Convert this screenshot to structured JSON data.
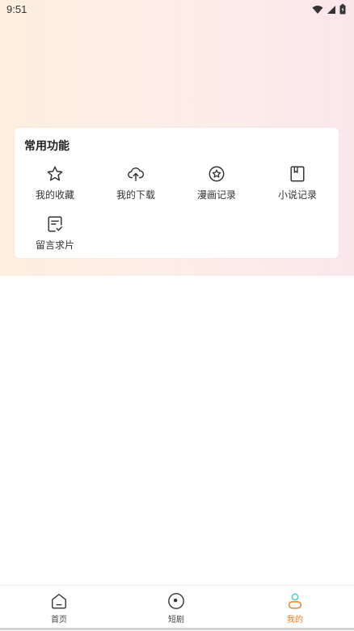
{
  "status_bar": {
    "time": "9:51",
    "icons": [
      "wifi-icon",
      "signal-icon",
      "battery-icon"
    ]
  },
  "common_functions": {
    "title": "常用功能",
    "items": [
      {
        "label": "我的收藏",
        "icon": "star-icon"
      },
      {
        "label": "我的下载",
        "icon": "cloud-upload-icon"
      },
      {
        "label": "漫画记录",
        "icon": "star-circle-icon"
      },
      {
        "label": "小说记录",
        "icon": "book-bookmark-icon"
      },
      {
        "label": "留言求片",
        "icon": "note-check-icon"
      }
    ]
  },
  "tab_bar": {
    "tabs": [
      {
        "label": "首页",
        "icon": "home-icon",
        "active": false
      },
      {
        "label": "短剧",
        "icon": "play-circle-icon",
        "active": false
      },
      {
        "label": "我的",
        "icon": "profile-icon",
        "active": true
      }
    ]
  },
  "colors": {
    "accent": "#ff7a1a",
    "profile_icon_teal": "#3fd6c9",
    "hero_gradient_left": "#fdeedd",
    "hero_gradient_right": "#fbe6ec"
  }
}
